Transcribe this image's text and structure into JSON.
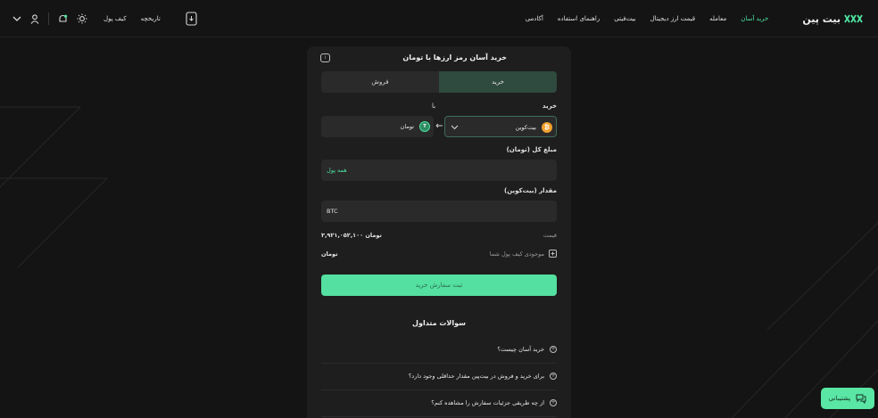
{
  "header": {
    "wallet_label": "کیف پول",
    "history_label": "تاریخچه",
    "nav": [
      "خرید آسان",
      "معامله",
      "قیمت ارز دیجیتال",
      "بیت‌فیتی",
      "راهنمای استفاده",
      "آکادمی"
    ],
    "logo_text": "بیت پین"
  },
  "card": {
    "title": "خرید آسان رمز ارزها با تومان",
    "tabs": {
      "buy": "خرید",
      "sell": "فروش"
    },
    "buy_label": "خرید",
    "with_label": "با",
    "coin_name": "بیت‌کوین",
    "fiat_name": "تومان",
    "total_label": "مبلغ کل (تومان)",
    "total_placeholder": "همه پول",
    "amount_label": "مقدار (بیت‌کوین)",
    "amount_unit": "BTC",
    "price_label": "قیمت",
    "price_value": "۳,۹۲۱,۰۵۲,۱۰۰ تومان",
    "balance_label": "موجودی کیف پول شما",
    "balance_value": "تومان",
    "submit_label": "ثبت سفارش خرید",
    "faq_title": "سوالات متداول",
    "faq": [
      "خرید آسان چیست؟",
      "برای خرید و فروش در بیت‌پین مقدار حداقلی وجود دارد؟",
      "از چه طریقی جزئیات سفارش را مشاهده کنم؟"
    ]
  },
  "support_label": "پشتیبانی",
  "colors": {
    "accent": "#54e0a0",
    "background": "#141414",
    "card": "#1e1e1e"
  }
}
